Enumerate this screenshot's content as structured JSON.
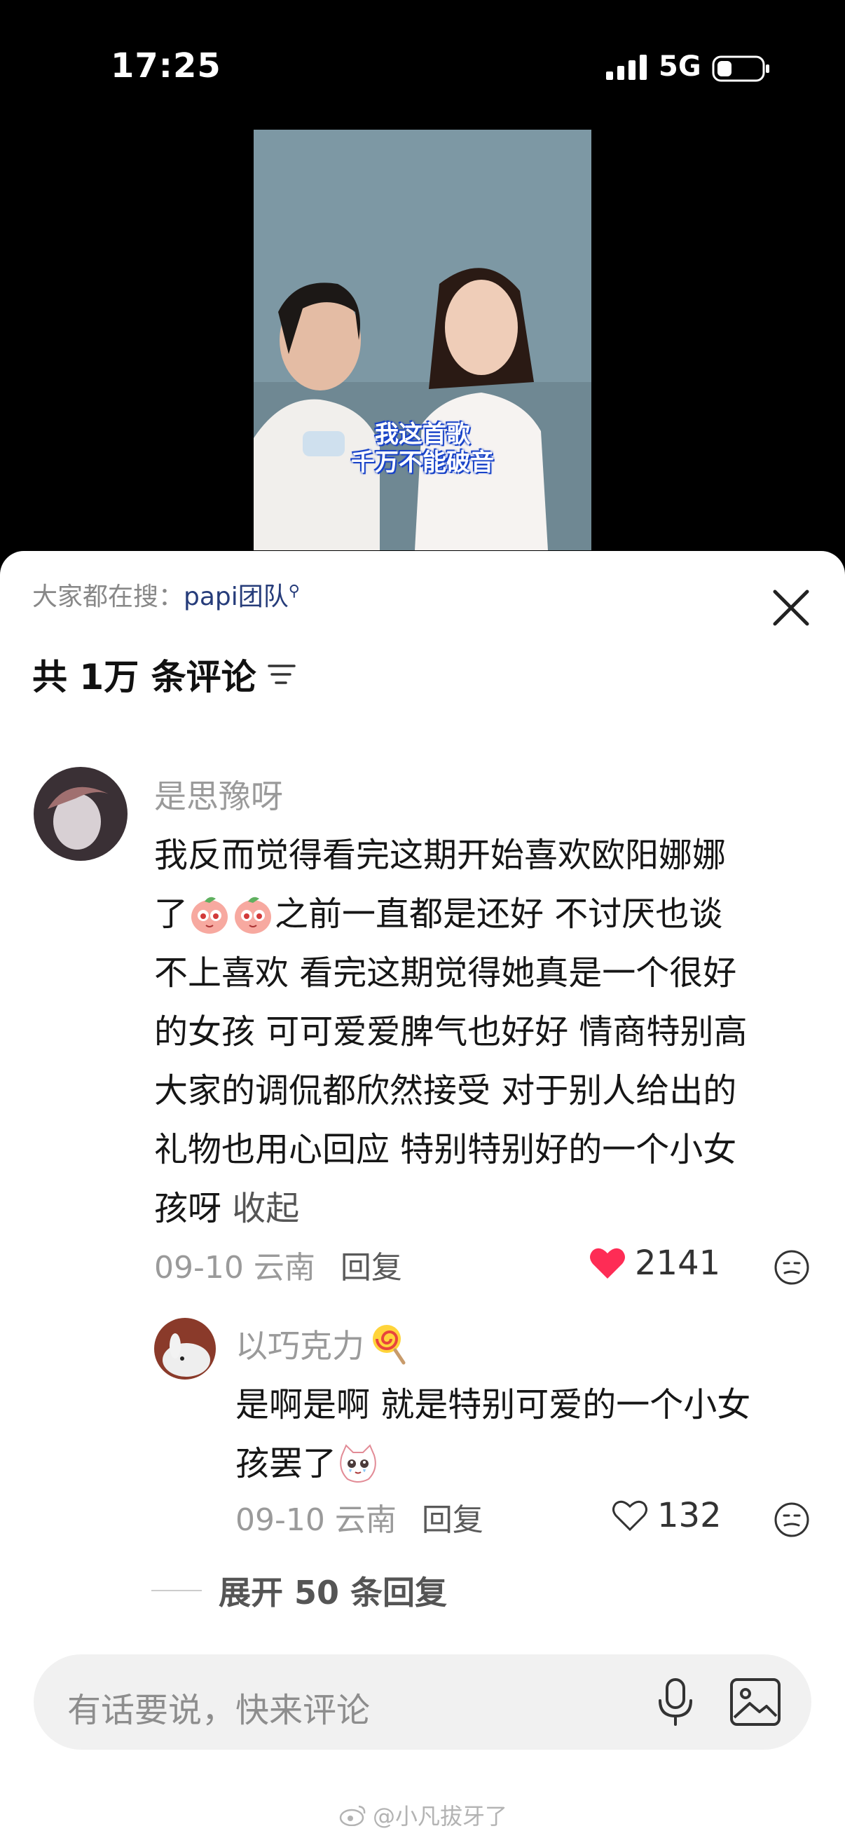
{
  "status": {
    "time": "17:25",
    "network": "5G"
  },
  "video": {
    "caption_line1": "我这首歌",
    "caption_line2": "千万不能破音"
  },
  "sheet": {
    "search_prefix": "大家都在搜：",
    "search_keyword": "papi团队",
    "comment_count": "共 1万 条评论"
  },
  "comments": [
    {
      "user": "是思豫呀",
      "line1": "我反而觉得看完这期开始喜欢欧阳娜娜",
      "line2a": "了",
      "line2b": "之前一直都是还好 不讨厌也谈",
      "line3": "不上喜欢 看完这期觉得她真是一个很好",
      "line4": "的女孩 可可爱爱脾气也好好 情商特别高",
      "line5": "大家的调侃都欣然接受 对于别人给出的",
      "line6": "礼物也用心回应 特别特别好的一个小女",
      "line7": "孩呀",
      "collapse": "收起",
      "date": "09-10",
      "location": "云南",
      "reply_label": "回复",
      "likes": "2141",
      "liked": true
    },
    {
      "user": "以巧克力",
      "line1": "是啊是啊 就是特别可爱的一个小女",
      "line2": "孩罢了",
      "date": "09-10",
      "location": "云南",
      "reply_label": "回复",
      "likes": "132",
      "liked": false
    }
  ],
  "expand_replies": "展开 50 条回复",
  "input": {
    "placeholder": "有话要说，快来评论"
  },
  "watermark": "@小凡拔牙了",
  "colors": {
    "like_red": "#fe2c55",
    "keyword_blue": "#263c7a"
  }
}
